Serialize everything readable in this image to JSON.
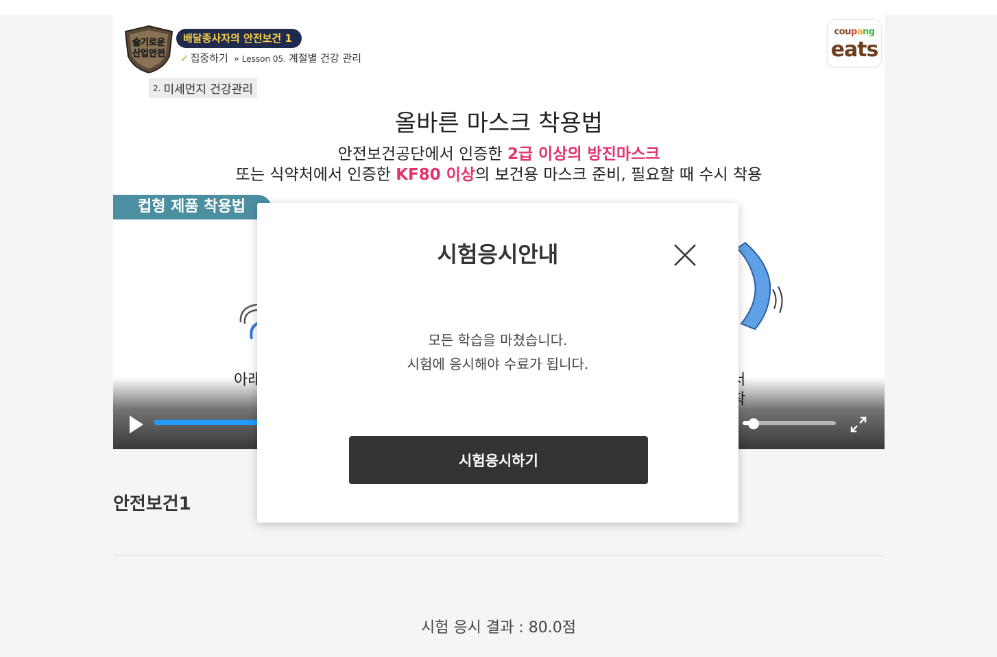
{
  "player": {
    "course_logo_text": "슬기로운 산업안전",
    "course_title": "배달종사자의 안전보건 1",
    "breadcrumb": {
      "focus": "집중하기",
      "arrows": "»",
      "lesson": "Lesson 05.",
      "lesson_title": "계절별 건강 관리"
    },
    "section_number": "2.",
    "section_label": "미세먼지 건강관리",
    "brand": {
      "top": [
        "cou",
        "p",
        "a",
        "ng"
      ],
      "main": "eats"
    },
    "slide": {
      "heading": "올바른 마스크 착용법",
      "line1_prefix": "안전보건공단에서 인증한 ",
      "line1_highlight": "2급 이상의 방진마스크",
      "line2_prefix": "또는 식약처에서 인증한 ",
      "line2_highlight": "KF80 이상",
      "line2_suffix": "의 보건용 마스크 준비, 필요할 때 수시 착용",
      "tab_label": "컵형 제품 착용법",
      "step_left_partial": "아래",
      "step_right_partial_1": "서",
      "step_right_partial_2": "착"
    },
    "controls": {
      "progress": 0.2,
      "volume": 0.12
    }
  },
  "course_name": "안전보건1",
  "result_text": "시험 응시 결과 : 80.0점",
  "modal": {
    "title": "시험응시안내",
    "message_line1": "모든 학습을 마쳤습니다.",
    "message_line2": "시험에 응시해야 수료가 됩니다.",
    "button_label": "시험응시하기"
  },
  "colors": {
    "accent_blue": "#1e9cff",
    "highlight_pink": "#e2336e",
    "tab_teal": "#4b8fa1",
    "button_dark": "#333333"
  },
  "icons": {
    "play": "play-icon",
    "fullscreen": "fullscreen-icon",
    "close": "close-icon"
  }
}
